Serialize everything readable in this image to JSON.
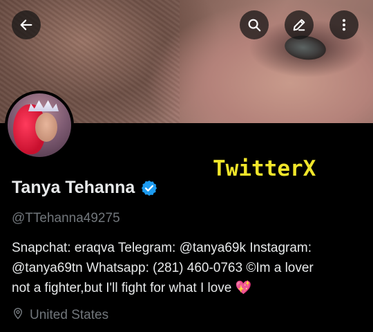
{
  "header": {
    "back_icon": "arrow-left-icon",
    "search_icon": "search-icon",
    "edit_icon": "pencil-icon",
    "more_icon": "more-vertical-icon"
  },
  "watermark": "TwitterX",
  "profile": {
    "name": "Tanya Tehanna",
    "verified_icon": "verified-badge-icon",
    "handle": "@TTehanna49275",
    "bio_lines": [
      "Snapchat: eraqva  Telegram: @tanya69k Instagram:",
      "@tanya69tn  Whatsapp: (281) 460-0763 ©Im a lover",
      "not a fighter,but I'll fight for what I love "
    ],
    "bio_emoji": "💖",
    "location": "United States",
    "location_icon": "map-pin-icon"
  },
  "colors": {
    "background": "#000000",
    "verified": "#1d9bf0",
    "watermark": "#f0e52a",
    "secondary_text": "#71767b"
  }
}
